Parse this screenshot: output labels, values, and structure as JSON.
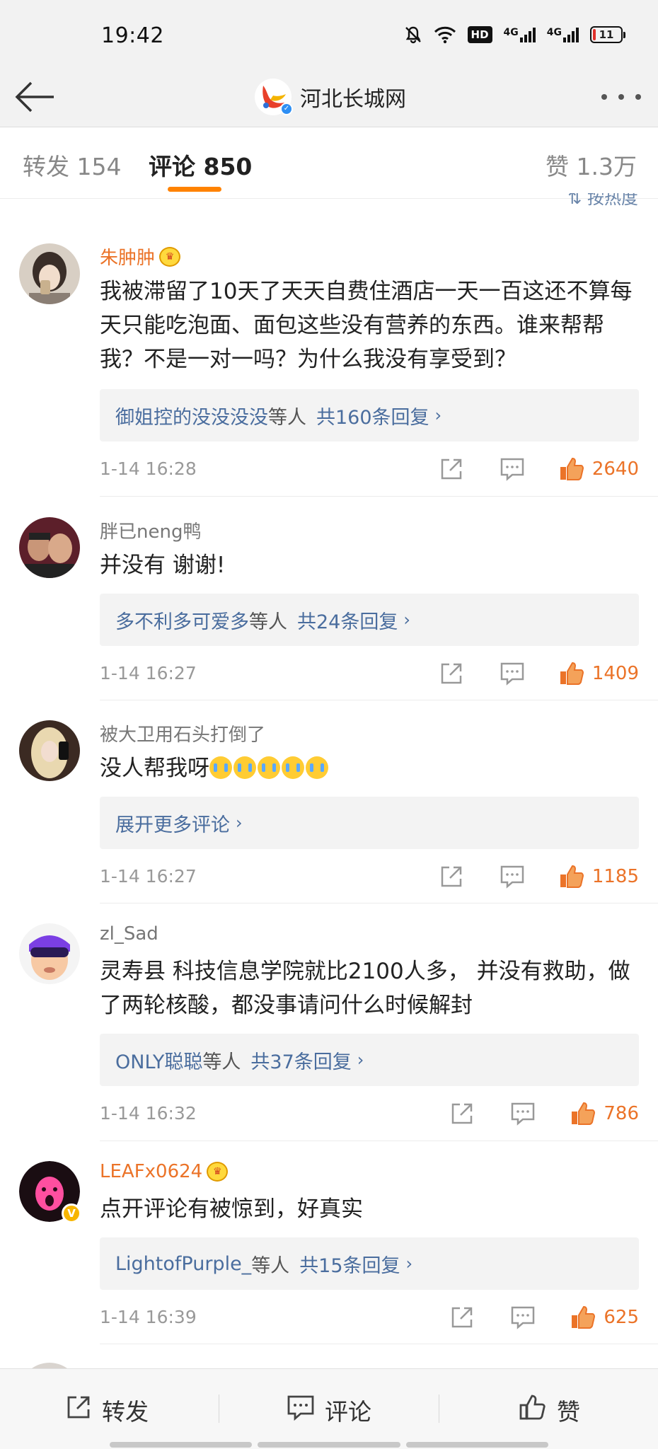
{
  "status_bar": {
    "time": "19:42",
    "network_label_1": "4G",
    "network_label_2": "4G",
    "hd_label": "HD",
    "battery": "11"
  },
  "nav": {
    "title": "河北长城网",
    "back_icon": "back-arrow-icon",
    "more_icon": "more-dots-icon"
  },
  "tabs": {
    "repost": "转发 154",
    "comments": "评论 850",
    "likes": "赞 1.3万",
    "sort_label_partial": "按热度"
  },
  "colors": {
    "accent_orange": "#ff8200",
    "username_orange": "#eb7328",
    "link_blue": "#4a6d9e"
  },
  "comments": [
    {
      "username": "朱肿肿",
      "text": "我被滞留了10天了天天自费住酒店一天一百这还不算每天只能吃泡面、面包这些没有营养的东西。谁来帮帮我？不是一对一吗？为什么我没有享受到？",
      "reply_names": "御姐控的没没没没",
      "reply_by": "等人",
      "reply_count": "共160条回复",
      "date": "1-14 16:28",
      "likes": "2640"
    },
    {
      "username": "胖已neng鸭",
      "text": "并没有 谢谢!",
      "reply_names": "多不利多可爱多",
      "reply_by": "等人",
      "reply_count": "共24条回复",
      "date": "1-14 16:27",
      "likes": "1409"
    },
    {
      "username": "被大卫用石头打倒了",
      "text": "没人帮我呀",
      "reply_expand": "展开更多评论",
      "date": "1-14 16:27",
      "likes": "1185"
    },
    {
      "username": "zl_Sad",
      "text": "灵寿县 科技信息学院就比2100人多， 并没有救助，做了两轮核酸，都没事请问什么时候解封",
      "reply_names": "ONLY聪聪",
      "reply_by": "等人",
      "reply_count": "共37条回复",
      "date": "1-14 16:32",
      "likes": "786"
    },
    {
      "username": "LEAFx0624",
      "text": "点开评论有被惊到，好真实",
      "reply_names": "LightofPurple_",
      "reply_by": "等人",
      "reply_count": "共15条回复",
      "date": "1-14 16:39",
      "likes": "625"
    }
  ],
  "bottom_bar": {
    "repost": "转发",
    "comment": "评论",
    "like": "赞"
  }
}
